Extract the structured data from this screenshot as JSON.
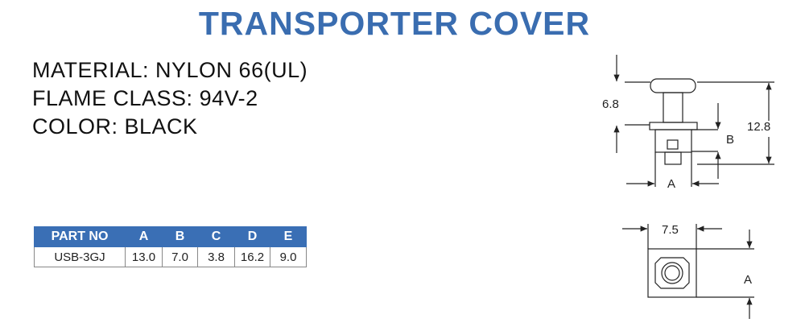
{
  "title": "TRANSPORTER COVER",
  "specs": {
    "material": "MATERIAL: NYLON 66(UL)",
    "flame_class": "FLAME CLASS: 94V-2",
    "color": "COLOR: BLACK"
  },
  "table": {
    "headers": [
      "PART NO",
      "A",
      "B",
      "C",
      "D",
      "E"
    ],
    "rows": [
      [
        "USB-3GJ",
        "13.0",
        "7.0",
        "3.8",
        "16.2",
        "9.0"
      ]
    ]
  },
  "drawing": {
    "dim_6_8": "6.8",
    "dim_12_8": "12.8",
    "label_b": "B",
    "label_a_side": "A",
    "dim_7_5": "7.5",
    "label_a_top": "A"
  }
}
